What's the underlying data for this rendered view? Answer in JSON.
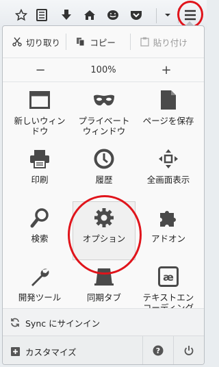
{
  "toolbar": {
    "icons": [
      "star-icon",
      "reading-list-icon",
      "download-icon",
      "home-icon",
      "social-icon",
      "pocket-icon",
      "menu-dropdown-icon",
      "hamburger-menu-icon"
    ]
  },
  "edit": {
    "cut": "切り取り",
    "copy": "コピー",
    "paste": "貼り付け"
  },
  "zoom": {
    "minus": "−",
    "value": "100%",
    "plus": "+"
  },
  "tiles": [
    {
      "label": "新しいウィン\nドウ"
    },
    {
      "label": "プライベート\nウィンドウ"
    },
    {
      "label": "ページを保存"
    },
    {
      "label": "印刷"
    },
    {
      "label": "履歴"
    },
    {
      "label": "全画面表示"
    },
    {
      "label": "検索"
    },
    {
      "label": "オプション"
    },
    {
      "label": "アドオン"
    },
    {
      "label": "開発ツール"
    },
    {
      "label": "同期タブ"
    },
    {
      "label": "テキストエン\nコーディング"
    }
  ],
  "sync": {
    "label": "Sync にサインイン"
  },
  "bottom": {
    "customize": "カスタマイズ"
  },
  "colors": {
    "highlight_ring": "#e0141b",
    "icon": "#4a4a4a"
  }
}
